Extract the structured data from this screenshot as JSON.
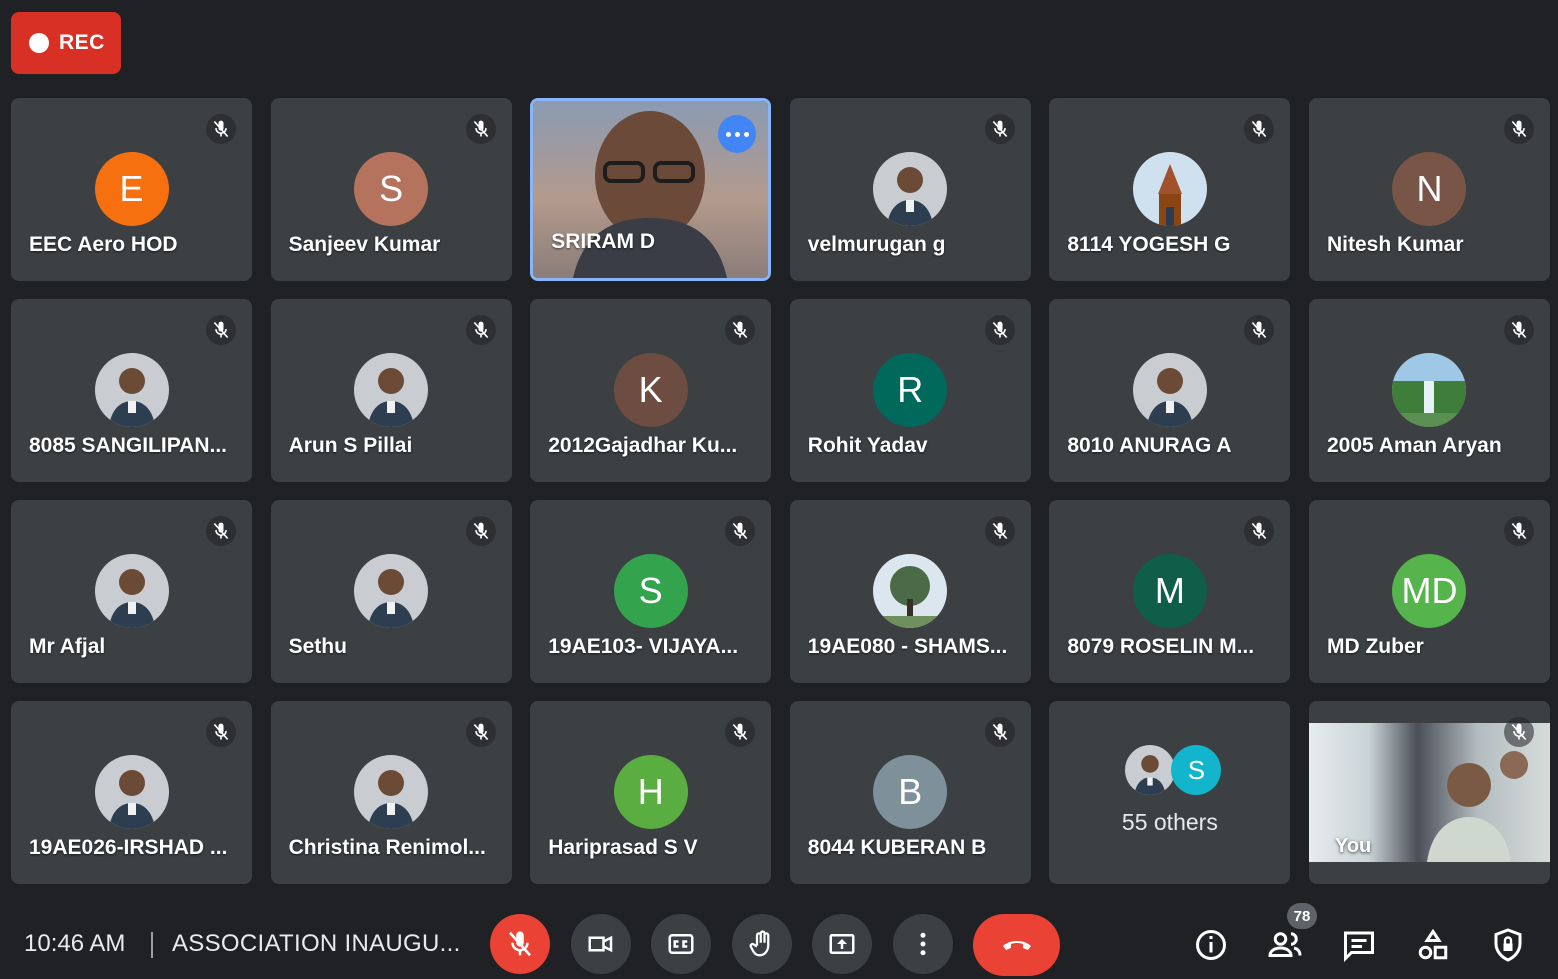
{
  "recording": {
    "label": "REC"
  },
  "participants": [
    {
      "name": "EEC Aero HOD",
      "initial": "E",
      "color": "#f6700f",
      "muted": true
    },
    {
      "name": "Sanjeev Kumar",
      "initial": "S",
      "color": "#b5735e",
      "muted": true
    },
    {
      "name": "SRIRAM D",
      "video": true,
      "active_speaker": true
    },
    {
      "name": "velmurugan g",
      "photo": "profile-photo",
      "muted": true
    },
    {
      "name": "8114 YOGESH G",
      "photo": "temple-photo",
      "muted": true
    },
    {
      "name": "Nitesh Kumar",
      "initial": "N",
      "color": "#795548",
      "muted": true
    },
    {
      "name": "8085 SANGILIPAN...",
      "photo": "profile-photo",
      "muted": true
    },
    {
      "name": "Arun S Pillai",
      "photo": "profile-photo",
      "muted": true
    },
    {
      "name": "2012Gajadhar Ku...",
      "initial": "K",
      "color": "#6d4c41",
      "muted": true
    },
    {
      "name": "Rohit Yadav",
      "initial": "R",
      "color": "#00695c",
      "muted": true
    },
    {
      "name": "8010 ANURAG A",
      "photo": "profile-photo",
      "muted": true
    },
    {
      "name": "2005 Aman Aryan",
      "photo": "waterfall-photo",
      "muted": true
    },
    {
      "name": "Mr Afjal",
      "photo": "profile-photo",
      "muted": true
    },
    {
      "name": "Sethu",
      "photo": "profile-photo",
      "muted": true
    },
    {
      "name": "19AE103- VIJAYA...",
      "initial": "S",
      "color": "#33a34d",
      "muted": true
    },
    {
      "name": "19AE080 - SHAMS...",
      "photo": "tree-photo",
      "muted": true
    },
    {
      "name": "8079 ROSELIN M...",
      "initial": "M",
      "color": "#0f5e4a",
      "muted": true
    },
    {
      "name": "MD Zuber",
      "initial": "MD",
      "color": "#55b44b",
      "muted": true
    },
    {
      "name": "19AE026-IRSHAD ...",
      "photo": "profile-photo",
      "muted": true
    },
    {
      "name": "Christina Renimol...",
      "photo": "profile-photo",
      "muted": true
    },
    {
      "name": "Hariprasad S V",
      "initial": "H",
      "color": "#5aad40",
      "muted": true
    },
    {
      "name": "8044 KUBERAN B",
      "initial": "B",
      "color": "#7e909a",
      "muted": true
    }
  ],
  "others": {
    "label": "55 others",
    "mini_initial": "S",
    "mini_color": "#12b5cb"
  },
  "self": {
    "label": "You"
  },
  "bottom_bar": {
    "time": "10:46 AM",
    "meeting_title": "ASSOCIATION INAUGU...",
    "controls": [
      "mic-off-icon",
      "camera-icon",
      "captions-icon",
      "raise-hand-icon",
      "present-icon",
      "more-options-icon",
      "end-call-icon"
    ],
    "right_icons": [
      "info-icon",
      "people-icon",
      "chat-icon",
      "activities-icon",
      "host-controls-icon"
    ],
    "participant_count": "78"
  },
  "colors": {
    "background": "#202124",
    "tile": "#3c4043",
    "red": "#ea4335",
    "active_border": "#8ab4f8"
  }
}
